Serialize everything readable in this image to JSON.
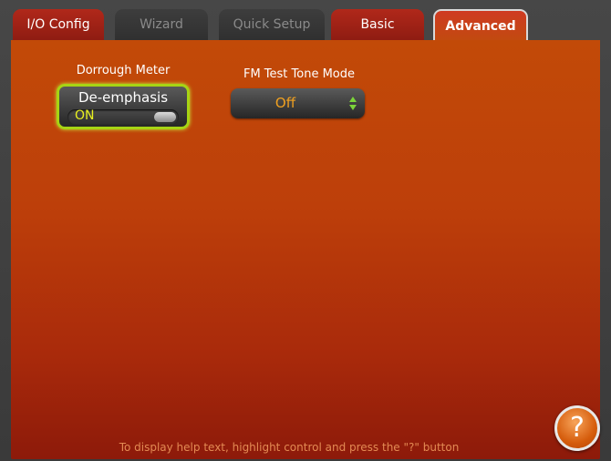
{
  "tabs": [
    {
      "label": "I/O Config",
      "state": "active"
    },
    {
      "label": "Wizard",
      "state": "disabled"
    },
    {
      "label": "Quick Setup",
      "state": "disabled"
    },
    {
      "label": "Basic",
      "state": "active"
    },
    {
      "label": "Advanced",
      "state": "selected"
    }
  ],
  "dorrough": {
    "section_label": "Dorrough Meter",
    "title": "De-emphasis",
    "state": "ON"
  },
  "fm_test_tone": {
    "section_label": "FM Test Tone Mode",
    "value": "Off"
  },
  "help": {
    "text": "To display help text, highlight control and press the \"?\" button",
    "button_label": "?"
  },
  "colors": {
    "panel_top": "#c24a08",
    "panel_bottom": "#8d1a0a",
    "toggle_border": "#a7d414",
    "toggle_state": "#e8f021",
    "select_value": "#f0a020",
    "help_text": "#e38a53"
  },
  "icons": {
    "select_arrows": "up-down-arrows-icon",
    "help_button": "question-mark-icon"
  }
}
